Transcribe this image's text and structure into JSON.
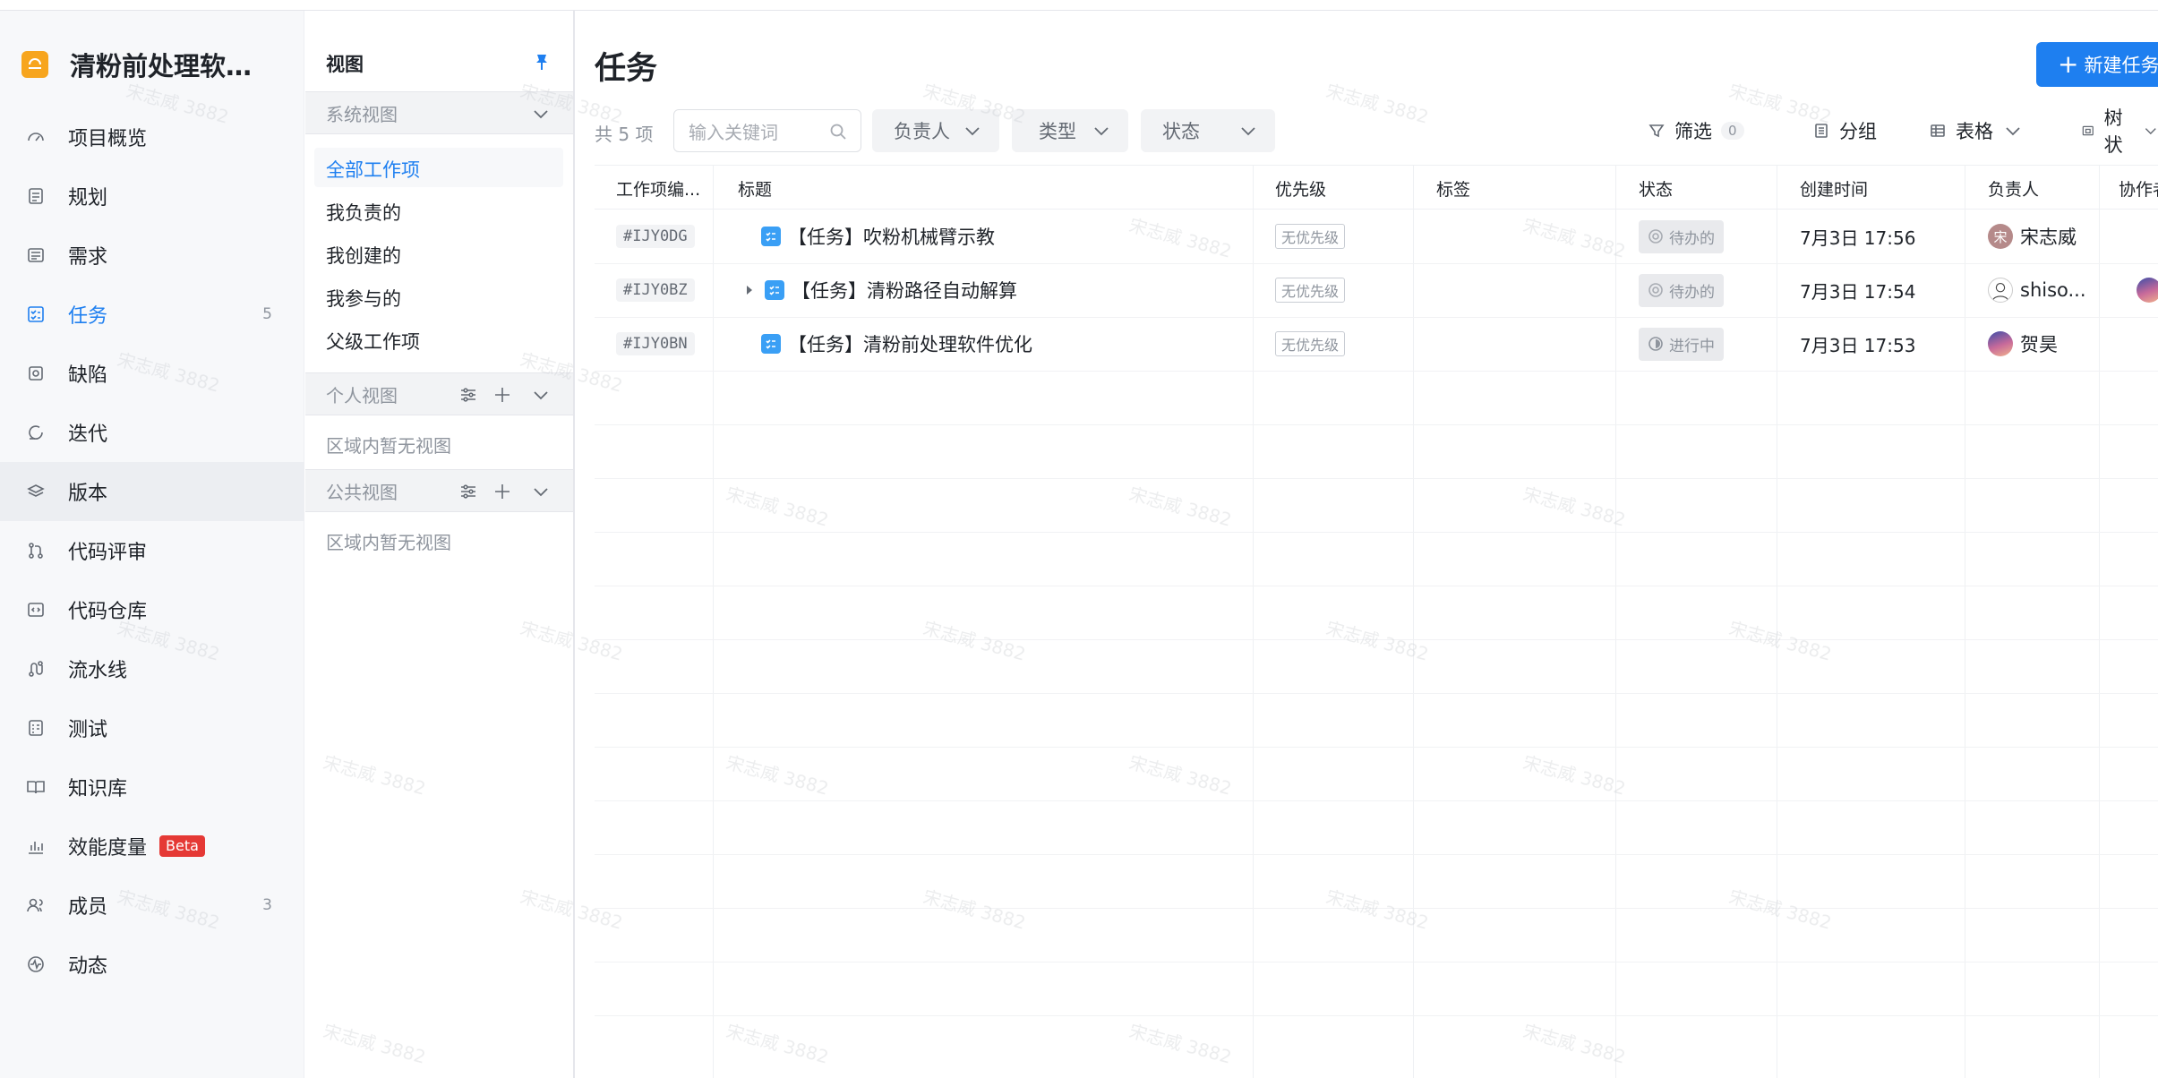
{
  "project": {
    "name": "清粉前处理软…",
    "logo_icon": "project-logo-icon",
    "accent": "#f7a51e"
  },
  "nav": [
    {
      "label": "项目概览",
      "icon": "dashboard-icon",
      "count": ""
    },
    {
      "label": "规划",
      "icon": "plan-icon",
      "count": ""
    },
    {
      "label": "需求",
      "icon": "requirement-icon",
      "count": ""
    },
    {
      "label": "任务",
      "icon": "task-icon",
      "count": "5"
    },
    {
      "label": "缺陷",
      "icon": "bug-icon",
      "count": ""
    },
    {
      "label": "迭代",
      "icon": "iteration-icon",
      "count": ""
    },
    {
      "label": "版本",
      "icon": "layers-icon",
      "count": ""
    },
    {
      "label": "代码评审",
      "icon": "pull-request-icon",
      "count": ""
    },
    {
      "label": "代码仓库",
      "icon": "code-icon",
      "count": ""
    },
    {
      "label": "流水线",
      "icon": "pipeline-icon",
      "count": ""
    },
    {
      "label": "测试",
      "icon": "test-icon",
      "count": ""
    },
    {
      "label": "知识库",
      "icon": "book-icon",
      "count": ""
    },
    {
      "label": "效能度量",
      "icon": "bar-chart-icon",
      "count": "",
      "badge": "Beta"
    },
    {
      "label": "成员",
      "icon": "members-icon",
      "count": "3"
    },
    {
      "label": "动态",
      "icon": "activity-icon",
      "count": ""
    }
  ],
  "views": {
    "title": "视图",
    "system_section": "系统视图",
    "system_items": [
      "全部工作项",
      "我负责的",
      "我创建的",
      "我参与的",
      "父级工作项"
    ],
    "personal_section": "个人视图",
    "personal_empty": "区域内暂无视图",
    "public_section": "公共视图",
    "public_empty": "区域内暂无视图"
  },
  "main": {
    "title": "任务",
    "new_button": "新建任务",
    "total": "共 5 项",
    "search_placeholder": "输入关键词",
    "filters": [
      "负责人",
      "类型",
      "状态"
    ],
    "filter_label": "筛选",
    "filter_count": "0",
    "group_label": "分组",
    "table_label": "表格",
    "tree_label": "树状"
  },
  "table": {
    "columns": [
      "工作项编...",
      "标题",
      "优先级",
      "标签",
      "状态",
      "创建时间",
      "负责人",
      "协作者"
    ],
    "rows": [
      {
        "code": "#IJY0DG",
        "title": "【任务】吹粉机械臂示教",
        "priority": "无优先级",
        "tag": "",
        "status": "待办的",
        "created": "7月3日 17:56",
        "assignee": "宋志威",
        "avatar_text": "宋",
        "expand": false
      },
      {
        "code": "#IJY0BZ",
        "title": "【任务】清粉路径自动解算",
        "priority": "无优先级",
        "tag": "",
        "status": "待办的",
        "created": "7月3日 17:54",
        "assignee": "shiso...",
        "avatar_text": "",
        "expand": true
      },
      {
        "code": "#IJY0BN",
        "title": "【任务】清粉前处理软件优化",
        "priority": "无优先级",
        "tag": "",
        "status": "进行中",
        "created": "7月3日 17:53",
        "assignee": "贺昊",
        "avatar_text": "",
        "expand": false
      }
    ]
  },
  "watermark": "宋志威 3882",
  "colors": {
    "primary": "#1e7ff0",
    "beta": "#e53935",
    "task": "#3a9ff5"
  }
}
